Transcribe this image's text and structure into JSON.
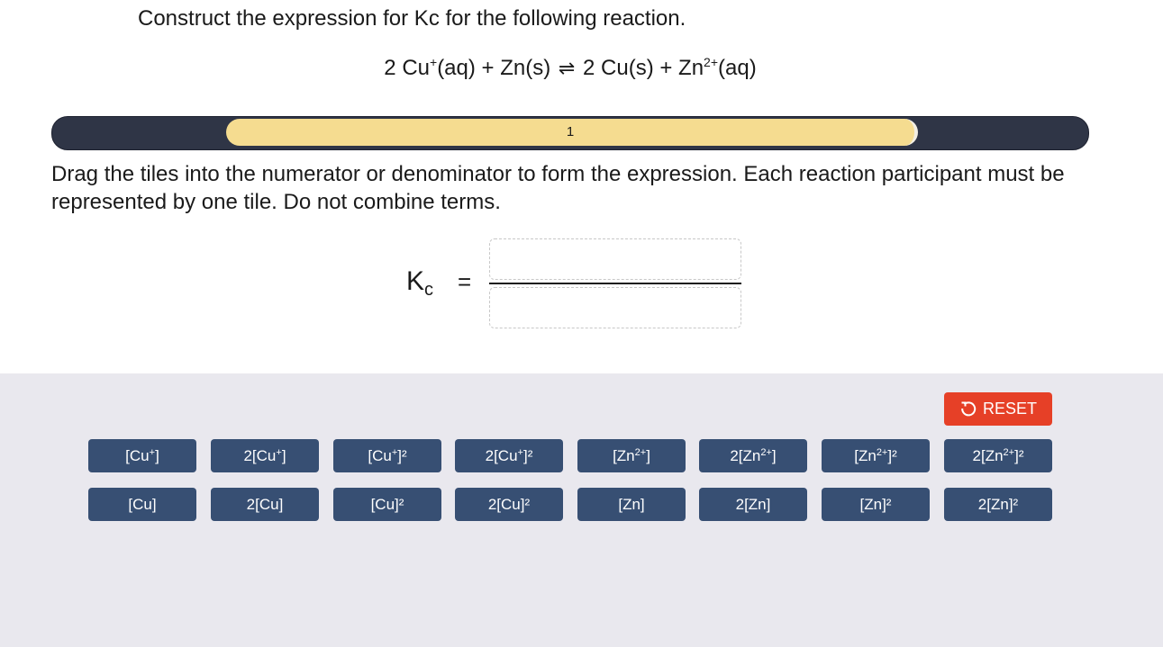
{
  "question": {
    "title": "Construct the expression for Kc for the following reaction."
  },
  "equation": {
    "left_part1": "2 Cu",
    "left_sup1": "+",
    "left_part2": "(aq) + Zn(s)",
    "arrow": "⇌",
    "right_part1": "2 Cu(s) + Zn",
    "right_sup1": "2+",
    "right_part2": "(aq)"
  },
  "progress": {
    "label": "1"
  },
  "instructions": "Drag the tiles into the numerator or denominator to form the expression. Each reaction participant must be represented by one tile. Do not combine terms.",
  "expression": {
    "k": "K",
    "k_sub": "c",
    "equals": "="
  },
  "reset": {
    "label": "RESET",
    "icon": "reset-arrow-icon"
  },
  "tiles": {
    "row1": [
      {
        "pre": "[Cu",
        "sup": "+",
        "post": "]"
      },
      {
        "pre": "2[Cu",
        "sup": "+",
        "post": "]"
      },
      {
        "pre": "[Cu",
        "sup": "+",
        "post": "]²"
      },
      {
        "pre": "2[Cu",
        "sup": "+",
        "post": "]²"
      },
      {
        "pre": "[Zn",
        "sup": "2+",
        "post": "]"
      },
      {
        "pre": "2[Zn",
        "sup": "2+",
        "post": "]"
      },
      {
        "pre": "[Zn",
        "sup": "2+",
        "post": "]²"
      },
      {
        "pre": "2[Zn",
        "sup": "2+",
        "post": "]²"
      }
    ],
    "row2": [
      {
        "label": "[Cu]"
      },
      {
        "label": "2[Cu]"
      },
      {
        "label": "[Cu]²"
      },
      {
        "label": "2[Cu]²"
      },
      {
        "label": "[Zn]"
      },
      {
        "label": "2[Zn]"
      },
      {
        "label": "[Zn]²"
      },
      {
        "label": "2[Zn]²"
      }
    ]
  }
}
